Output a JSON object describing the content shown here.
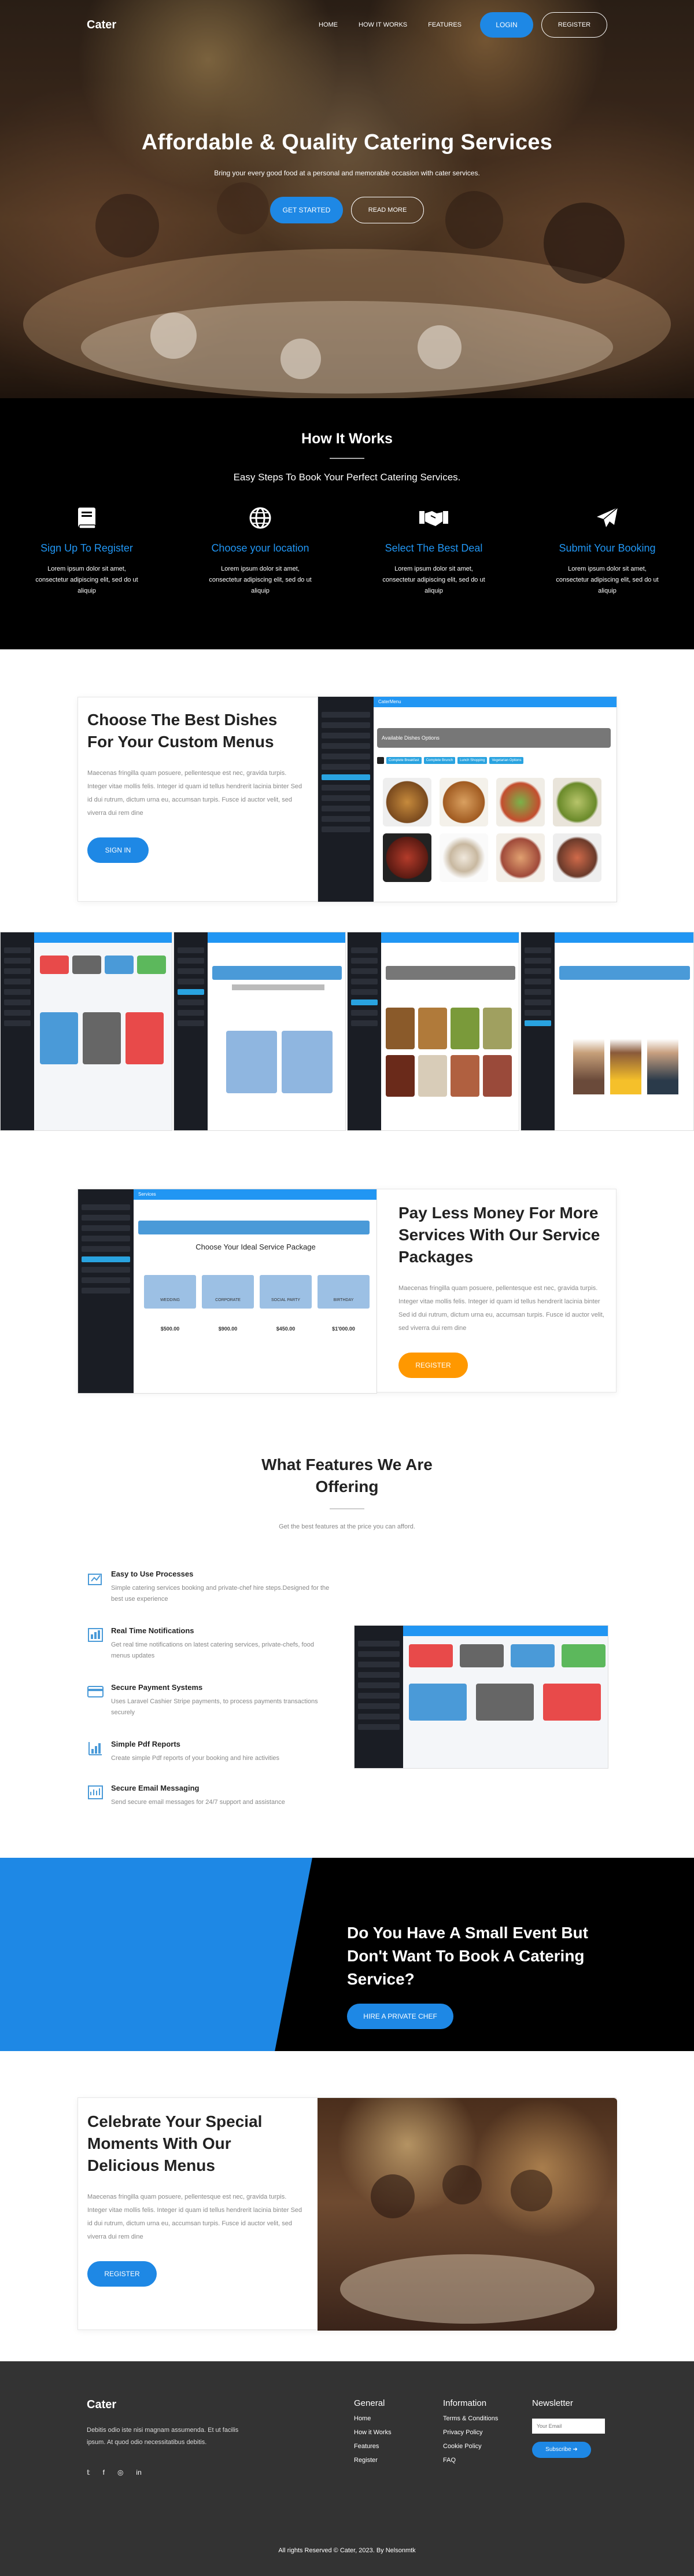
{
  "nav": {
    "logo": "Cater",
    "links": [
      "HOME",
      "HOW IT WORKS",
      "FEATURES"
    ],
    "login": "LOGIN",
    "register": "REGISTER"
  },
  "hero": {
    "title": "Affordable & Quality Catering Services",
    "subtitle": "Bring your every good food at a personal and memorable occasion with cater services.",
    "cta_primary": "GET STARTED",
    "cta_secondary": "READ MORE"
  },
  "how": {
    "title": "How It Works",
    "subtitle": "Easy Steps To Book Your Perfect Catering Services.",
    "steps": [
      {
        "icon": "book-icon",
        "title": "Sign Up To Register",
        "text": "Lorem ipsum dolor sit amet, consectetur adipiscing elit, sed do ut aliquip"
      },
      {
        "icon": "globe-icon",
        "title": "Choose your location",
        "text": "Lorem ipsum dolor sit amet, consectetur adipiscing elit, sed do ut aliquip"
      },
      {
        "icon": "handshake-icon",
        "title": "Select The Best Deal",
        "text": "Lorem ipsum dolor sit amet, consectetur adipiscing elit, sed do ut aliquip"
      },
      {
        "icon": "paper-plane-icon",
        "title": "Submit Your Booking",
        "text": "Lorem ipsum dolor sit amet, consectetur adipiscing elit, sed do ut aliquip"
      }
    ]
  },
  "dishes": {
    "title": "Choose The Best Dishes For Your Custom Menus",
    "text": "Maecenas fringilla quam posuere, pellentesque est nec, gravida turpis. Integer vitae mollis felis. Integer id quam id tellus hendrerit lacinia binter Sed id dui rutrum, dictum urna eu, accumsan turpis. Fusce id auctor velit, sed viverra dui rem dine",
    "button": "SIGN IN",
    "screenshot": {
      "brand": "CaterMenu",
      "panel_title": "Available Dishes Options",
      "pills": [
        "Complete Breakfast",
        "Complete Brunch",
        "Lunch Shopping",
        "Vegetarian Options"
      ]
    }
  },
  "pay": {
    "title": "Pay Less Money For More Services With Our Service Packages",
    "text": "Maecenas fringilla quam posuere, pellentesque est nec, gravida turpis. Integer vitae mollis felis. Integer id quam id tellus hendrerit lacinia binter Sed id dui rutrum, dictum urna eu, accumsan turpis. Fusce id auctor velit, sed viverra dui rem dine",
    "button": "REGISTER",
    "screenshot": {
      "brand": "Services",
      "heading": "Choose Your Ideal Service Package",
      "packages": [
        {
          "name": "WEDDING",
          "price": "$500.00"
        },
        {
          "name": "CORPORATE",
          "price": "$900.00"
        },
        {
          "name": "SOCIAL PARTY",
          "price": "$450.00"
        },
        {
          "name": "BIRTHDAY",
          "price": "$1'000.00"
        }
      ]
    }
  },
  "features": {
    "title": "What Features We Are Offering",
    "subtitle": "Get the best features at the price you can afford.",
    "items": [
      {
        "icon": "process-icon",
        "title": "Easy to Use Processes",
        "text": "Simple catering services booking and private-chef hire steps.Designed for the best use experience"
      },
      {
        "icon": "notification-icon",
        "title": "Real Time Notifications",
        "text": "Get real time notifications on latest catering services, private-chefs, food menus updates"
      },
      {
        "icon": "payment-icon",
        "title": "Secure Payment Systems",
        "text": "Uses Laravel Cashier Stripe payments, to process payments transactions securely"
      },
      {
        "icon": "report-icon",
        "title": "Simple Pdf Reports",
        "text": "Create simple Pdf reports of your booking and hire activities"
      },
      {
        "icon": "message-icon",
        "title": "Secure Email Messaging",
        "text": "Send secure email messages for 24/7 support and assistance"
      }
    ]
  },
  "event": {
    "title": "Do You Have A Small Event But Don't Want To Book A Catering Service?",
    "button": "HIRE A PRIVATE CHEF"
  },
  "celebrate": {
    "title": "Celebrate Your Special Moments With Our Delicious Menus",
    "text": "Maecenas fringilla quam posuere, pellentesque est nec, gravida turpis. Integer vitae mollis felis. Integer id quam id tellus hendrerit lacinia binter Sed id dui rutrum, dictum urna eu, accumsan turpis. Fusce id auctor velit, sed viverra dui rem dine",
    "button": "REGISTER"
  },
  "footer": {
    "brand": "Cater",
    "about": "Debitis odio iste nisi magnam assumenda. Et ut facilis ipsum. At quod odio necessitatibus debitis.",
    "general_title": "General",
    "general_links": [
      "Home",
      "How it Works",
      "Features",
      "Register"
    ],
    "info_title": "Information",
    "info_links": [
      "Terms & Conditions",
      "Privacy Policy",
      "Cookie Policy",
      "FAQ"
    ],
    "newsletter_title": "Newsletter",
    "email_placeholder": "Your Email",
    "subscribe": "Subscribe",
    "socials": [
      "twitter-icon",
      "facebook-icon",
      "instagram-icon",
      "linkedin-icon"
    ],
    "copyright": "All rights Reserved © Cater, 2023. By Nelsonmtk"
  }
}
